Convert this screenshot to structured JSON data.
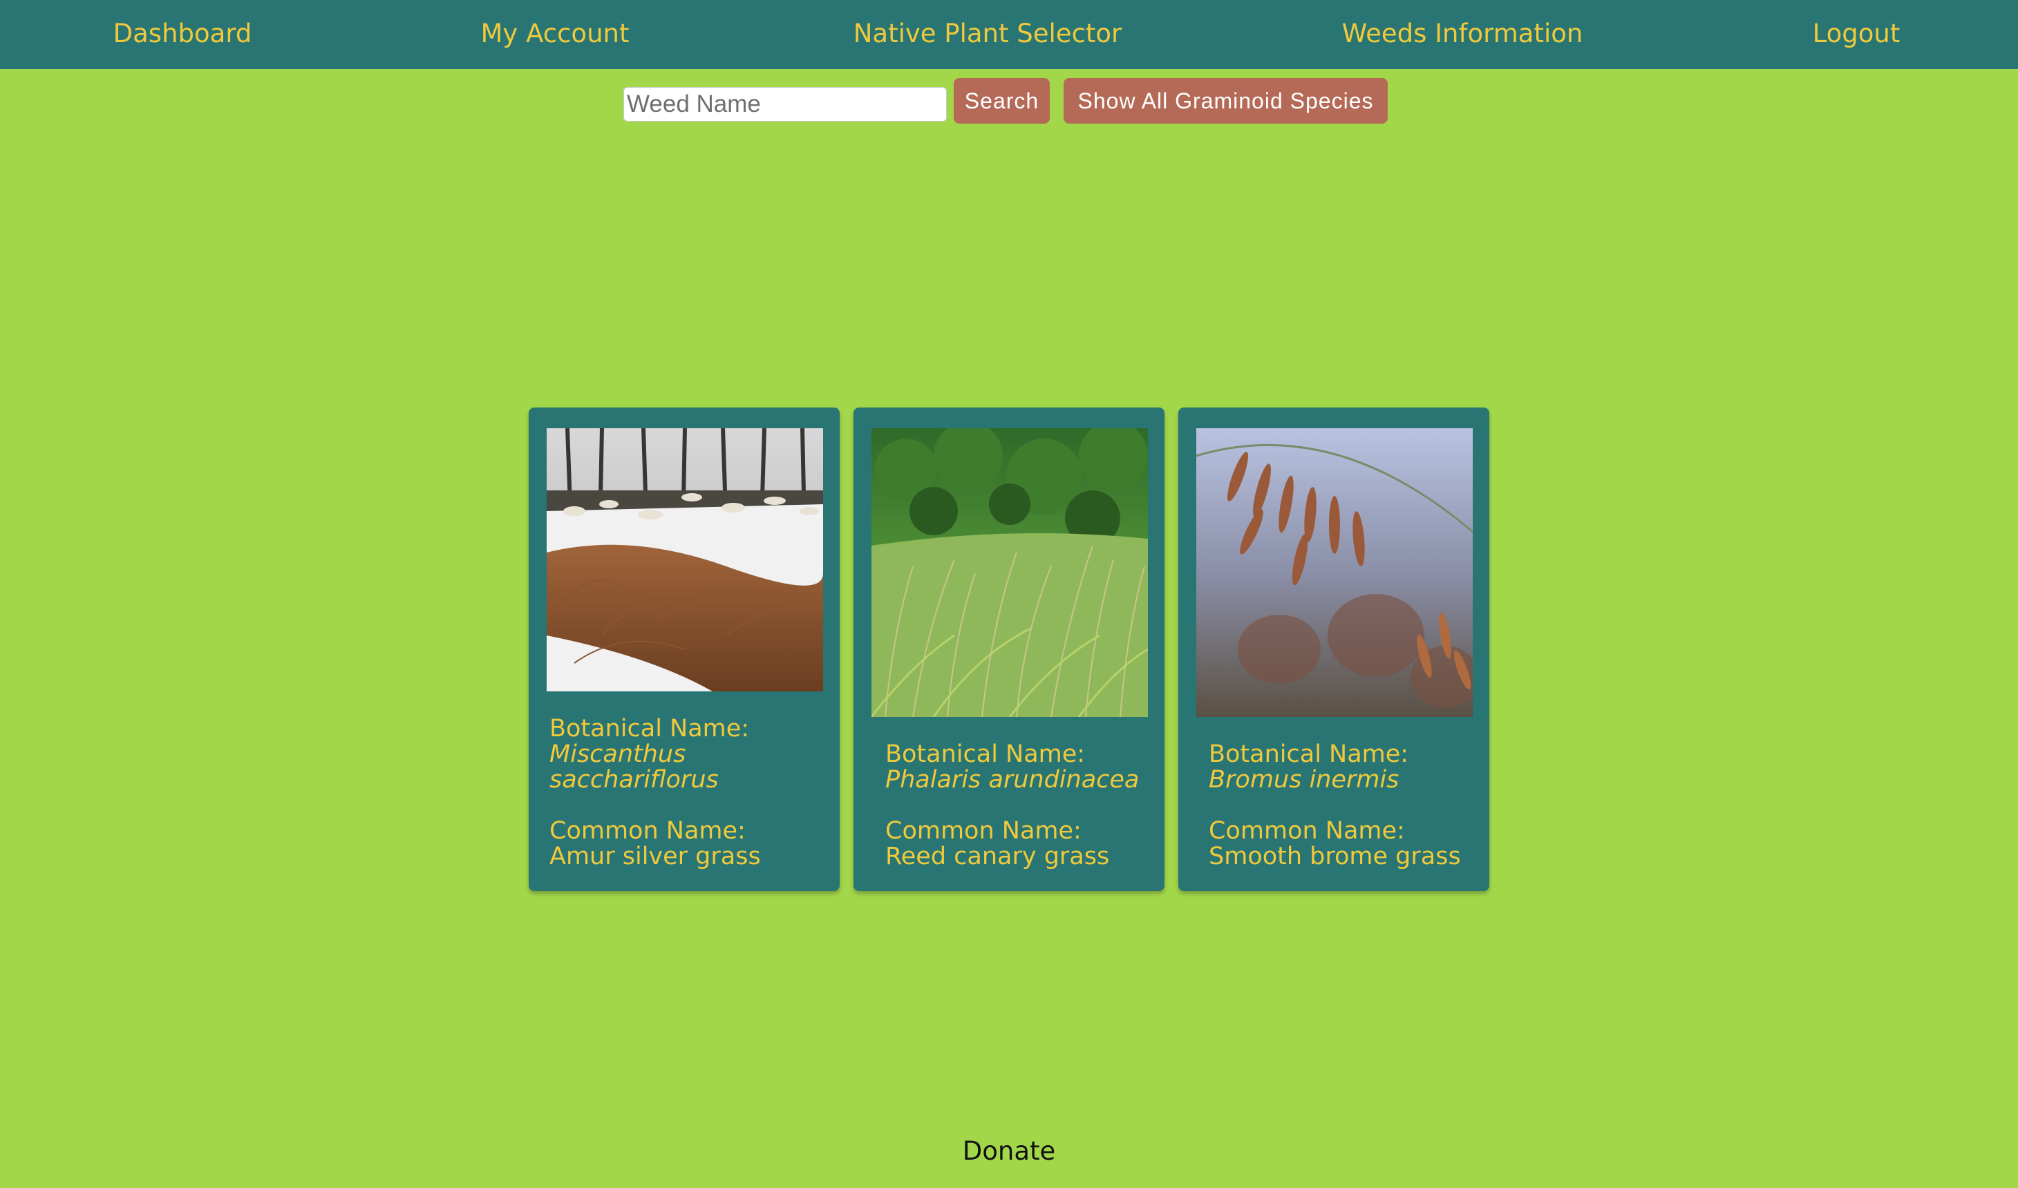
{
  "nav": {
    "items": [
      {
        "label": "Dashboard"
      },
      {
        "label": "My Account"
      },
      {
        "label": "Native Plant Selector"
      },
      {
        "label": "Weeds Information"
      },
      {
        "label": "Logout"
      }
    ]
  },
  "search": {
    "placeholder": "Weed Name",
    "value": "",
    "search_label": "Search",
    "show_all_label": "Show All Graminoid Species"
  },
  "cards": [
    {
      "botanical_label": "Botanical Name:",
      "botanical_name_line1": "Miscanthus",
      "botanical_name_line2": "sacchariflorus",
      "common_label": "Common Name:",
      "common_name": "Amur silver grass",
      "image": "amur-silver-grass-photo"
    },
    {
      "botanical_label": "Botanical Name:",
      "botanical_name_line1": "Phalaris arundinacea",
      "common_label": "Common Name:",
      "common_name": "Reed canary grass",
      "image": "reed-canary-grass-photo"
    },
    {
      "botanical_label": "Botanical Name:",
      "botanical_name_line1": "Bromus inermis",
      "common_label": "Common Name:",
      "common_name": "Smooth brome grass",
      "image": "smooth-brome-grass-photo"
    }
  ],
  "footer": {
    "donate_label": "Donate"
  },
  "colors": {
    "background": "#a2d74a",
    "navbar": "#287573",
    "accent_text": "#f0c93c",
    "button": "#b56a57"
  }
}
